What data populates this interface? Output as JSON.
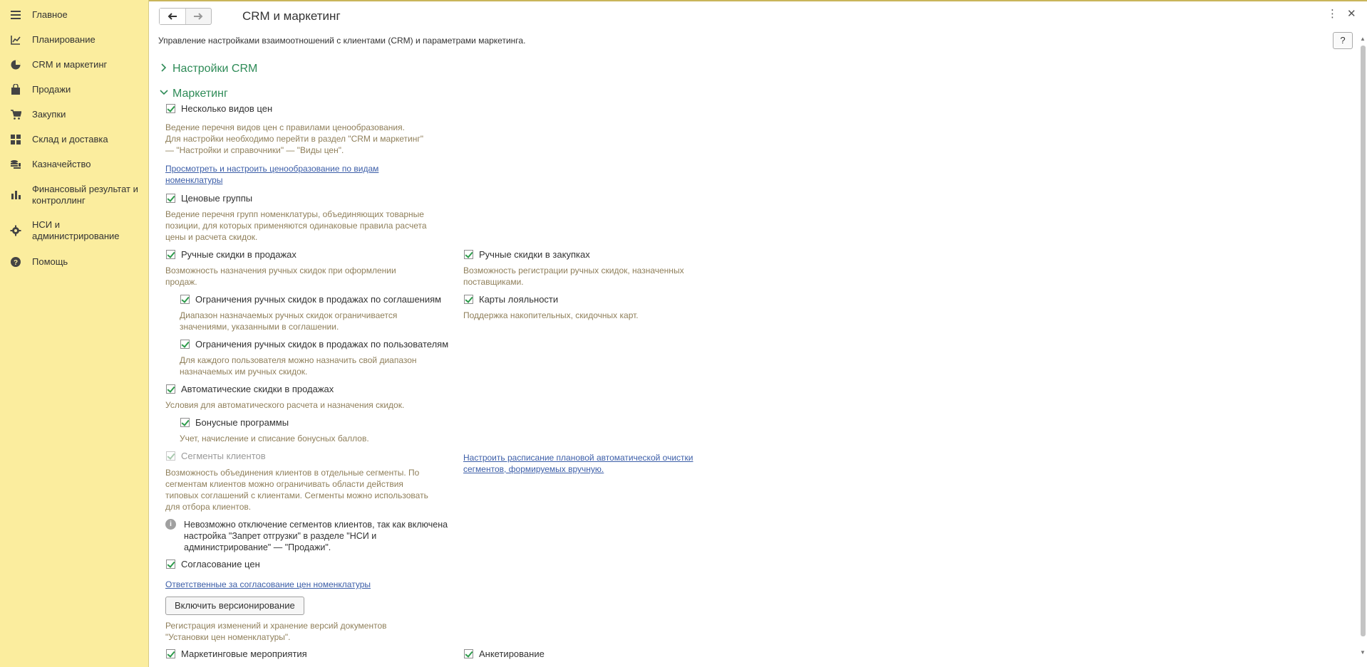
{
  "sidebar": {
    "items": [
      {
        "icon": "menu-icon",
        "label": "Главное"
      },
      {
        "icon": "planning-icon",
        "label": "Планирование"
      },
      {
        "icon": "pie-chart-icon",
        "label": "CRM и маркетинг"
      },
      {
        "icon": "shopping-bag-icon",
        "label": "Продажи"
      },
      {
        "icon": "shopping-cart-icon",
        "label": "Закупки"
      },
      {
        "icon": "grid-icon",
        "label": "Склад и доставка"
      },
      {
        "icon": "coins-icon",
        "label": "Казначейство"
      },
      {
        "icon": "bar-chart-icon",
        "label": "Финансовый результат и контроллинг"
      },
      {
        "icon": "gear-icon",
        "label": "НСИ и администрирование"
      },
      {
        "icon": "help-icon",
        "label": "Помощь"
      }
    ]
  },
  "header": {
    "title": "CRM и маркетинг",
    "description": "Управление настройками взаимоотношений с клиентами (CRM) и параметрами маркетинга.",
    "help_label": "?",
    "more_icon": "more-vertical-icon",
    "close_icon": "close-icon"
  },
  "sections": {
    "crm_settings": "Настройки CRM",
    "marketing": "Маркетинг"
  },
  "marketing": {
    "price_types": {
      "label": "Несколько видов цен",
      "note": "Ведение перечня видов цен с правилами ценообразования.\nДля настройки необходимо перейти в раздел \"CRM и маркетинг\"\n— \"Настройки и справочники\" — \"Виды цен\".",
      "link": "Просмотреть и настроить ценообразование по видам\nноменклатуры"
    },
    "price_groups": {
      "label": "Ценовые группы",
      "note": "Ведение перечня групп номенклатуры, объединяющих товарные\nпозиции, для которых применяются одинаковые правила расчета\nцены и расчета скидок."
    },
    "manual_discounts_sales": {
      "label": "Ручные скидки в продажах",
      "note": "Возможность назначения ручных скидок при оформлении\nпродаж."
    },
    "manual_discounts_purchases": {
      "label": "Ручные скидки в закупках",
      "note": "Возможность регистрации ручных скидок, назначенных\nпоставщиками."
    },
    "limit_by_agreements": {
      "label": "Ограничения ручных скидок в продажах по соглашениям",
      "note": "Диапазон назначаемых ручных скидок ограничивается\nзначениями, указанными в соглашении."
    },
    "loyalty_cards": {
      "label": "Карты лояльности",
      "note": "Поддержка накопительных, скидочных карт."
    },
    "limit_by_users": {
      "label": "Ограничения ручных скидок в продажах по пользователям",
      "note": "Для каждого пользователя можно назначить свой диапазон\nназначаемых им ручных скидок."
    },
    "auto_discounts": {
      "label": "Автоматические скидки в продажах",
      "note": "Условия для автоматического расчета и назначения скидок."
    },
    "bonus_programs": {
      "label": "Бонусные программы",
      "note": "Учет, начисление и списание бонусных баллов."
    },
    "client_segments": {
      "label": "Сегменты клиентов",
      "note": "Возможность объединения клиентов в отдельные сегменты. По\nсегментам клиентов можно ограничивать области действия\nтиповых соглашений с клиентами. Сегменты можно использовать\nдля отбора клиентов.",
      "schedule_link": "Настроить расписание плановой автоматической очистки\nсегментов, формируемых вручную.",
      "info": "Невозможно отключение сегментов клиентов, так как включена\nнастройка \"Запрет отгрузки\" в разделе \"НСИ и\nадминистрирование\" — \"Продажи\"."
    },
    "price_approval": {
      "label": "Согласование цен",
      "link": "Ответственные за согласование цен номенклатуры"
    },
    "versioning": {
      "button": "Включить версионирование",
      "note": "Регистрация изменений и хранение версий документов\n\"Установки цен номенклатуры\"."
    },
    "marketing_events": {
      "label": "Маркетинговые мероприятия"
    },
    "surveys": {
      "label": "Анкетирование"
    }
  }
}
